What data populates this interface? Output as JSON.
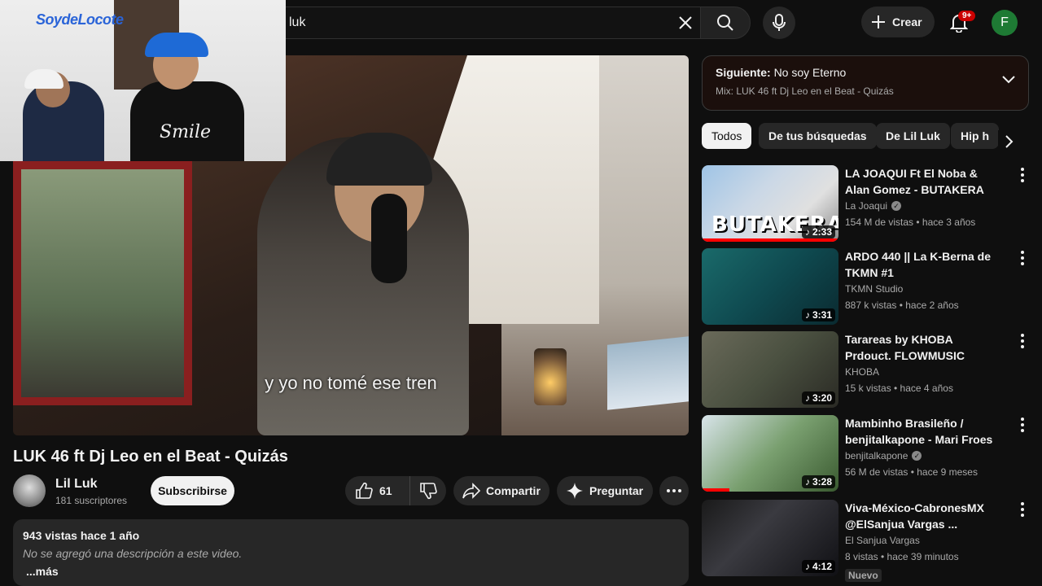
{
  "search": {
    "query": "luk"
  },
  "header": {
    "create_label": "Crear",
    "notif_badge": "9+",
    "avatar_initial": "F"
  },
  "video": {
    "subtitle": "y yo no tomé ese tren"
  },
  "pip": {
    "logo_text": "SoydeLocote",
    "shirt_text": "Smile"
  },
  "main": {
    "title": "LUK 46 ft Dj Leo en el Beat - Quizás",
    "channel": {
      "name": "Lil Luk",
      "subs": "181 suscriptores"
    },
    "subscribe_label": "Subscribirse",
    "likes": "61",
    "share_label": "Compartir",
    "ask_label": "Preguntar",
    "description": {
      "meta": "943 vistas  hace 1 año",
      "text": "No se agregó una descripción a este video.",
      "more": "...más"
    }
  },
  "next_up": {
    "label": "Siguiente:",
    "title": "No soy Eterno",
    "mix": "Mix: LUK 46 ft Dj Leo en el Beat - Quizás"
  },
  "chips": [
    "Todos",
    "De tus búsquedas",
    "De Lil Luk",
    "Hip h"
  ],
  "recommendations": [
    {
      "title": "LA JOAQUI Ft El Noba & Alan Gomez - BUTAKERA",
      "channel": "La Joaqui",
      "verified": true,
      "meta": "154 M de vistas • hace 3 años",
      "duration": "2:33",
      "thumb_text": "BUTAKERA",
      "watched": 1.0
    },
    {
      "title": "ARDO 440 || La K-Berna de TKMN #1",
      "channel": "TKMN Studio",
      "verified": false,
      "meta": "887 k vistas • hace 2 años",
      "duration": "3:31"
    },
    {
      "title": "Tarareas by KHOBA Prdouct. FLOWMUSIC",
      "channel": "KHOBA",
      "verified": false,
      "meta": "15 k vistas • hace 4 años",
      "duration": "3:20"
    },
    {
      "title": "Mambinho Brasileño / benjitalkapone - Mari Froes",
      "channel": "benjitalkapone",
      "verified": true,
      "meta": "56 M de vistas • hace 9 meses",
      "duration": "3:28",
      "watched": 0.2
    },
    {
      "title": "Viva-México-CabronesMX @ElSanjua Vargas ...",
      "channel": "El Sanjua Vargas",
      "verified": false,
      "meta": "8 vistas • hace 39 minutos",
      "duration": "4:12",
      "badge": "Nuevo"
    }
  ]
}
